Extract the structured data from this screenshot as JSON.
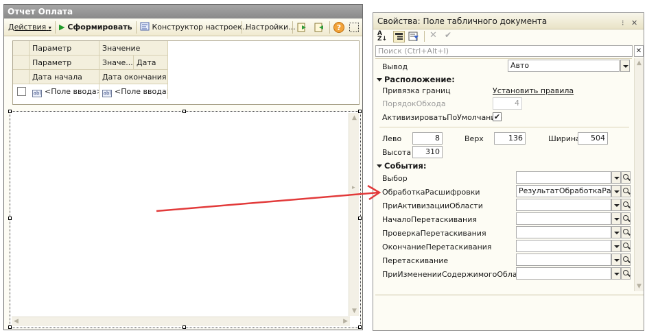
{
  "left_window": {
    "title": "Отчет  Оплата",
    "toolbar": {
      "actions_label": "Действия",
      "generate_label": "Сформировать",
      "constructor_label": "Конструктор настроек...",
      "settings_label": "Настройки..."
    },
    "grid": {
      "header_rows": [
        [
          "Параметр",
          "Значение",
          ""
        ],
        [
          "Параметр",
          "Значе...",
          "Дата"
        ],
        [
          "Дата начала",
          "Дата окончания",
          ""
        ]
      ],
      "data_row": {
        "checked": false,
        "field1": "<Поле ввода>",
        "field2": "<Поле ввода>",
        "field_icon": "abl"
      }
    }
  },
  "right_window": {
    "title": "Свойства: Поле табличного документа",
    "search_placeholder": "Поиск (Ctrl+Alt+I)",
    "output_label": "Вывод",
    "output_value": "Авто",
    "layout_section": "Расположение:",
    "anchor_label": "Привязка границ",
    "anchor_link": "Установить правила",
    "tab_order_label": "ПорядокОбхода",
    "tab_order_value": "4",
    "activate_default_label": "АктивизироватьПоУмолчанию",
    "activate_default_checked": true,
    "left_label": "Лево",
    "left_value": "8",
    "top_label": "Верх",
    "top_value": "136",
    "width_label": "Ширина",
    "width_value": "504",
    "height_label": "Высота",
    "height_value": "310",
    "events_section": "События:",
    "events": [
      {
        "label": "Выбор",
        "value": ""
      },
      {
        "label": "ОбработкаРасшифровки",
        "value": "РезультатОбработкаРасш"
      },
      {
        "label": "ПриАктивизацииОбласти",
        "value": ""
      },
      {
        "label": "НачалоПеретаскивания",
        "value": ""
      },
      {
        "label": "ПроверкаПеретаскивания",
        "value": ""
      },
      {
        "label": "ОкончаниеПеретаскивания",
        "value": ""
      },
      {
        "label": "Перетаскивание",
        "value": ""
      },
      {
        "label": "ПриИзмененииСодержимогоОбласти",
        "value": ""
      }
    ]
  },
  "colors": {
    "annotation_arrow": "#e23a3a",
    "panel_bg": "#fdfcf4",
    "title_bar": "#9a9a9a"
  }
}
